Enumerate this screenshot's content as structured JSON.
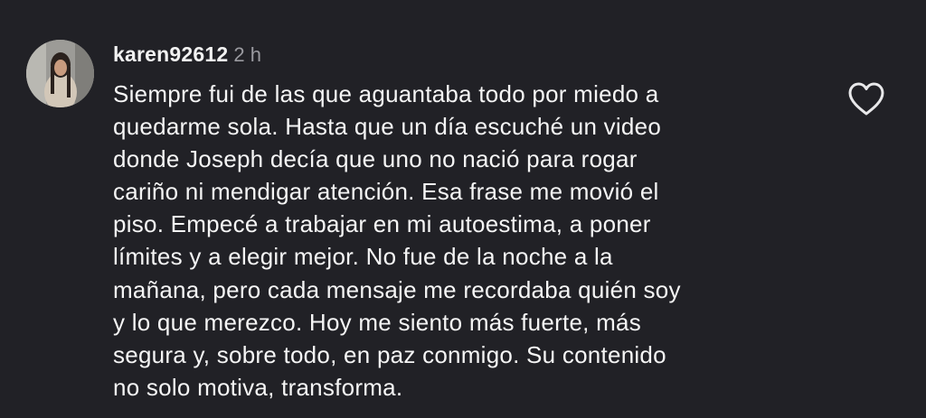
{
  "comment": {
    "username": "karen92612",
    "timestamp": "2 h",
    "body_lines": [
      "Siempre fui de las que aguantaba todo por miedo a",
      "quedarme sola. Hasta que un día escuché un video",
      "donde Joseph decía que uno no nació para rogar",
      "cariño ni mendigar atención. Esa frase me movió el",
      "piso. Empecé a trabajar en mi autoestima, a poner",
      "límites y a elegir mejor. No fue de la noche a la",
      "mañana, pero cada mensaje me recordaba quién soy",
      "y lo que merezco. Hoy me siento más fuerte, más",
      "segura y, sobre todo, en paz conmigo. Su contenido",
      "no solo motiva, transforma."
    ],
    "like_icon": "heart-outline-icon"
  },
  "colors": {
    "background": "#212126",
    "text": "#f5f5f5",
    "muted": "#9a9aa0"
  }
}
